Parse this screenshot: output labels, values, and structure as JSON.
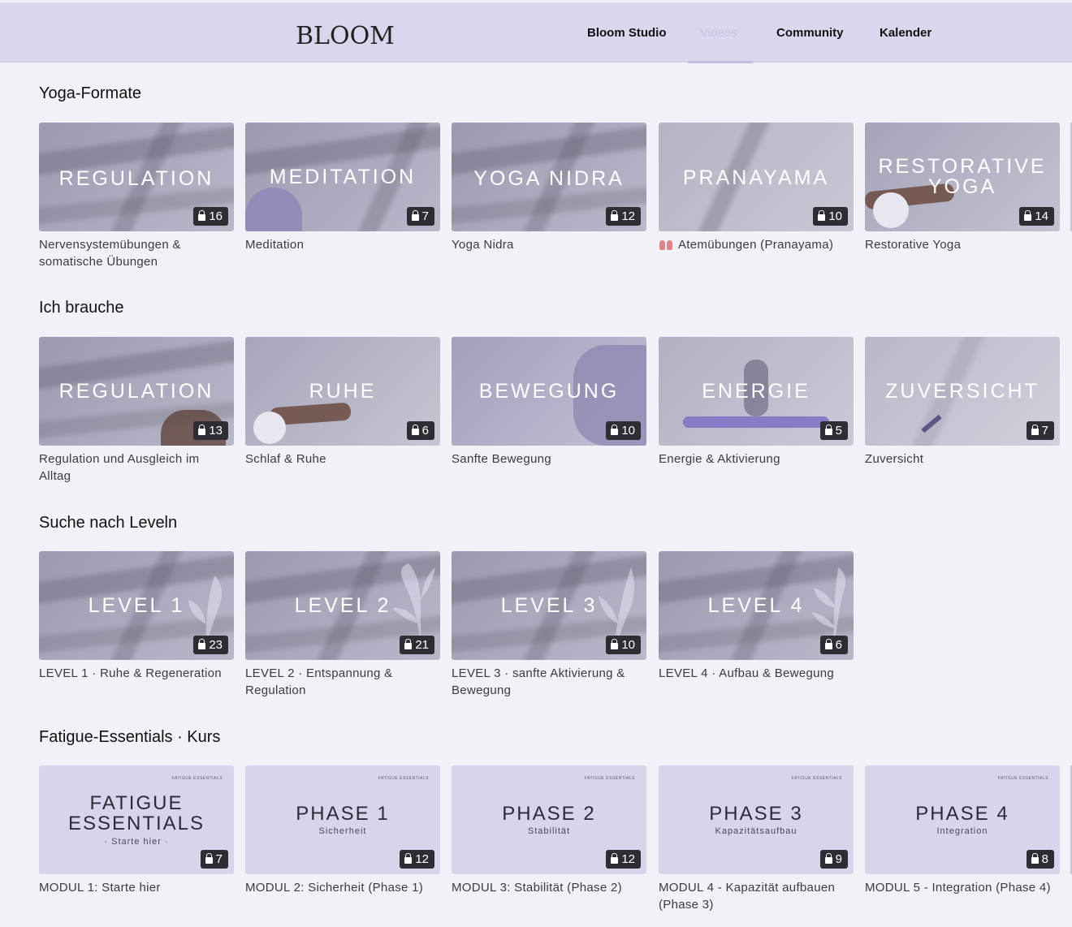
{
  "header": {
    "logo": "BLOOM",
    "nav": [
      "Bloom Studio",
      "Videos",
      "Community",
      "Kalender"
    ],
    "active_nav": "Videos"
  },
  "colors": {
    "header_bg": "#dad6ee",
    "page_bg": "#f2f1f8",
    "badge_bg": "#2e2d33",
    "lilac_card": "#d9d4ec"
  },
  "sections": [
    {
      "title": "Yoga-Formate",
      "cards": [
        {
          "thumb": "REGULATION",
          "count": "16",
          "label": "Nervensystemübungen & somatische Übungen"
        },
        {
          "thumb": "MEDITATION",
          "count": "7",
          "label": "Meditation"
        },
        {
          "thumb": "YOGA NIDRA",
          "count": "12",
          "label": "Yoga Nidra"
        },
        {
          "thumb": "PRANAYAMA",
          "count": "10",
          "label": "Atemübungen (Pranayama)",
          "icon": "lungs-icon"
        },
        {
          "thumb": "RESTORATIVE YOGA",
          "count": "14",
          "label": "Restorative Yoga"
        }
      ]
    },
    {
      "title": "Ich brauche",
      "cards": [
        {
          "thumb": "REGULATION",
          "count": "13",
          "label": "Regulation und Ausgleich im Alltag"
        },
        {
          "thumb": "RUHE",
          "count": "6",
          "label": "Schlaf & Ruhe"
        },
        {
          "thumb": "BEWEGUNG",
          "count": "10",
          "label": "Sanfte Bewegung"
        },
        {
          "thumb": "ENERGIE",
          "count": "5",
          "label": "Energie & Aktivierung"
        },
        {
          "thumb": "ZUVERSICHT",
          "count": "7",
          "label": "Zuversicht"
        }
      ]
    },
    {
      "title": "Suche nach Leveln",
      "cards": [
        {
          "thumb": "LEVEL 1",
          "count": "23",
          "label": "LEVEL 1 · Ruhe & Regeneration"
        },
        {
          "thumb": "LEVEL 2",
          "count": "21",
          "label": "LEVEL 2 · Entspannung & Regulation"
        },
        {
          "thumb": "LEVEL 3",
          "count": "10",
          "label": "LEVEL 3 · sanfte Aktivierung & Bewegung"
        },
        {
          "thumb": "LEVEL 4",
          "count": "6",
          "label": "LEVEL 4 · Aufbau & Bewegung"
        }
      ]
    },
    {
      "title": "Fatigue-Essentials · Kurs",
      "cards": [
        {
          "tag": "FATIGUE ESSENTIALS",
          "thumb_line1": "FATIGUE",
          "thumb_line2": "ESSENTIALS",
          "sub": "· Starte hier ·",
          "count": "7",
          "label": "MODUL 1: Starte hier"
        },
        {
          "tag": "FATIGUE ESSENTIALS",
          "thumb": "PHASE 1",
          "sub": "Sicherheit",
          "count": "12",
          "label": "MODUL 2: Sicherheit (Phase 1)"
        },
        {
          "tag": "FATIGUE ESSENTIALS",
          "thumb": "PHASE 2",
          "sub": "Stabilität",
          "count": "12",
          "label": "MODUL 3: Stabilität (Phase 2)"
        },
        {
          "tag": "FATIGUE ESSENTIALS",
          "thumb": "PHASE 3",
          "sub": "Kapazitätsaufbau",
          "count": "9",
          "label": "MODUL 4 - Kapazität aufbauen (Phase 3)"
        },
        {
          "tag": "FATIGUE ESSENTIALS",
          "thumb": "PHASE 4",
          "sub": "Integration",
          "count": "8",
          "label": "MODUL 5 - Integration (Phase 4)"
        }
      ]
    }
  ]
}
